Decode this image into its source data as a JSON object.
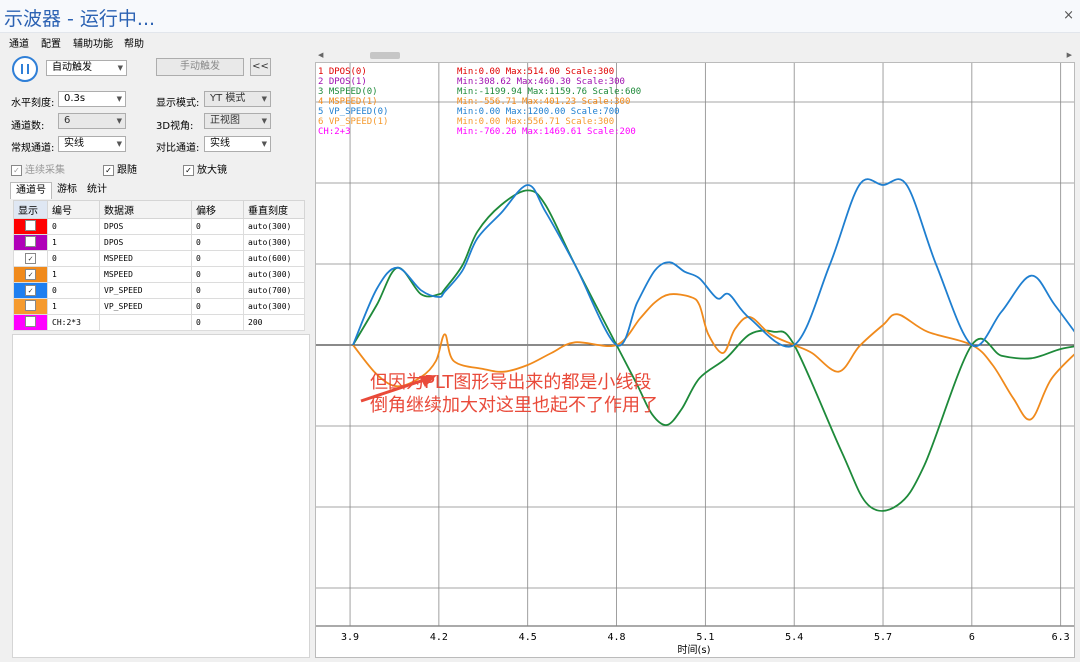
{
  "window": {
    "title": "示波器 - 运行中...",
    "close_glyph": "×"
  },
  "menu": [
    "通道",
    "配置",
    "辅助功能",
    "帮助"
  ],
  "toolbar": {
    "trigger_mode": "自动触发",
    "manual_trigger": "手动触发",
    "collapse": "<<"
  },
  "controls": {
    "h_scale_label": "水平刻度:",
    "h_scale_value": "0.3s",
    "display_mode_label": "显示模式:",
    "display_mode_value": "YT 模式",
    "channels_label": "通道数:",
    "channels_value": "6",
    "view3d_label": "3D视角:",
    "view3d_value": "正视图",
    "normal_ch_label": "常规通道:",
    "normal_ch_value": "实线",
    "compare_ch_label": "对比通道:",
    "compare_ch_value": "实线",
    "continuous": "连续采集",
    "follow": "跟随",
    "magnifier": "放大镜"
  },
  "tabs": [
    "通道号",
    "游标",
    "统计"
  ],
  "table": {
    "headers": [
      "显示",
      "编号",
      "数据源",
      "偏移",
      "垂直刻度"
    ],
    "rows": [
      {
        "color": "#ff0000",
        "checked": false,
        "num": "0",
        "src": "DPOS",
        "offset": "0",
        "scale": "auto(300)"
      },
      {
        "color": "#b000b8",
        "checked": false,
        "num": "1",
        "src": "DPOS",
        "offset": "0",
        "scale": "auto(300)"
      },
      {
        "color": "#ffffff",
        "checked": true,
        "num": "0",
        "src": "MSPEED",
        "offset": "0",
        "scale": "auto(600)"
      },
      {
        "color": "#f08a1c",
        "checked": true,
        "num": "1",
        "src": "MSPEED",
        "offset": "0",
        "scale": "auto(300)"
      },
      {
        "color": "#1f7ff0",
        "checked": true,
        "num": "0",
        "src": "VP_SPEED",
        "offset": "0",
        "scale": "auto(700)"
      },
      {
        "color": "#f59a2e",
        "checked": false,
        "num": "1",
        "src": "VP_SPEED",
        "offset": "0",
        "scale": "auto(300)"
      },
      {
        "color": "#ff00ff",
        "checked": false,
        "num": "CH:2*3",
        "src": "",
        "offset": "0",
        "scale": "200"
      }
    ]
  },
  "legend": [
    {
      "name": "1 DPOS(0)",
      "stats": "Min:0.00  Max:514.00  Scale:300",
      "color": "#e00000"
    },
    {
      "name": "2 DPOS(1)",
      "stats": "Min:308.62  Max:460.30  Scale:300",
      "color": "#a010b0"
    },
    {
      "name": "3 MSPEED(0)",
      "stats": "Min:-1199.94  Max:1159.76  Scale:600",
      "color": "#1e8a3a"
    },
    {
      "name": "4 MSPEED(1)",
      "stats": "Min:-556.71  Max:401.23  Scale:300",
      "color": "#f08a1c"
    },
    {
      "name": "5 VP_SPEED(0)",
      "stats": "Min:0.00  Max:1200.00  Scale:700",
      "color": "#1f7fd0"
    },
    {
      "name": "6 VP_SPEED(1)",
      "stats": "Min:0.00  Max:556.71  Scale:300",
      "color": "#f59a2e"
    },
    {
      "name": "CH:2+3",
      "stats": "Min:-760.26  Max:1469.61  Scale:200",
      "color": "#ff00ff"
    }
  ],
  "chart_data": {
    "type": "line",
    "xlabel": "时间(s)",
    "x_ticks": [
      "3.9",
      "4.2",
      "4.5",
      "4.8",
      "5.1",
      "5.4",
      "5.7",
      "6",
      "6.3"
    ],
    "x_tick_values": [
      3.9,
      4.2,
      4.5,
      4.8,
      5.1,
      5.4,
      5.7,
      6.0,
      6.3
    ],
    "xlim": [
      3.785,
      6.345
    ],
    "grid": true,
    "series": [
      {
        "name": "3 MSPEED(0)",
        "color": "#1e8a3a",
        "x": [
          3.91,
          3.99,
          4.06,
          4.14,
          4.2,
          4.22,
          4.28,
          4.33,
          4.41,
          4.5,
          4.56,
          4.66,
          4.8,
          4.87,
          4.92,
          4.97,
          5.02,
          5.08,
          5.17,
          5.25,
          5.33,
          5.4,
          5.56,
          5.65,
          5.75,
          5.84,
          6.0,
          6.1,
          6.2,
          6.3,
          6.38
        ],
        "y": [
          0,
          300,
          580,
          380,
          380,
          420,
          600,
          850,
          1050,
          1159.76,
          1050,
          600,
          0,
          -300,
          -520,
          -600,
          -480,
          -250,
          -100,
          80,
          100,
          0,
          -800,
          -1199.94,
          -1199.94,
          -900,
          0,
          -80,
          -100,
          -30,
          0
        ]
      },
      {
        "name": "4 MSPEED(1)",
        "color": "#f08a1c",
        "x": [
          3.91,
          3.99,
          4.06,
          4.14,
          4.19,
          4.22,
          4.25,
          4.35,
          4.42,
          4.5,
          4.58,
          4.66,
          4.8,
          4.88,
          4.93,
          4.98,
          5.05,
          5.08,
          5.11,
          5.16,
          5.2,
          5.25,
          5.32,
          5.4,
          5.46,
          5.55,
          5.62,
          5.7,
          5.75,
          5.85,
          6.0,
          6.07,
          6.14,
          6.2,
          6.27,
          6.38
        ],
        "y": [
          0,
          -220,
          -310,
          -240,
          -120,
          80,
          -120,
          -180,
          -200,
          -150,
          -60,
          20,
          0,
          200,
          320,
          380,
          360,
          300,
          80,
          -60,
          120,
          210,
          80,
          0,
          -60,
          -200,
          -10,
          150,
          230,
          100,
          0,
          -150,
          -400,
          -556.71,
          -250,
          0
        ]
      },
      {
        "name": "5 VP_SPEED(0)",
        "color": "#1f7fd0",
        "x": [
          3.91,
          3.99,
          4.06,
          4.14,
          4.2,
          4.22,
          4.28,
          4.33,
          4.41,
          4.5,
          4.56,
          4.66,
          4.8,
          4.87,
          4.93,
          4.98,
          5.03,
          5.08,
          5.14,
          5.18,
          5.25,
          5.4,
          5.52,
          5.62,
          5.7,
          5.78,
          5.88,
          6.0,
          6.1,
          6.2,
          6.28,
          6.38
        ],
        "y": [
          0,
          420,
          580,
          410,
          360,
          400,
          560,
          800,
          990,
          1200,
          1000,
          600,
          0,
          320,
          560,
          620,
          550,
          500,
          350,
          380,
          200,
          0,
          600,
          1200,
          1200,
          1200,
          600,
          0,
          250,
          520,
          300,
          0
        ]
      }
    ]
  },
  "annotation": {
    "line1": "但因为PLT图形导出来的都是小线段",
    "line2": "倒角继续加大对这里也起不了作用了",
    "color": "#e94a3a"
  }
}
